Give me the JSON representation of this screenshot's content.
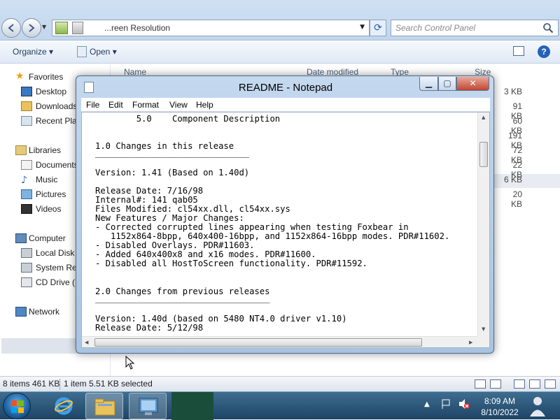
{
  "explorer": {
    "address_text": "...reen Resolution",
    "search_placeholder": "Search Control Panel",
    "toolbar": {
      "organize": "Organize",
      "open": "Open"
    },
    "columns": {
      "name": "Name",
      "date_modified": "Date modified",
      "type": "Type",
      "size": "Size"
    },
    "sizes": [
      "3 KB",
      "91 KB",
      "60 KB",
      "191 KB",
      "72 KB",
      "22 KB",
      "6 KB",
      "20 KB"
    ],
    "nav": {
      "favorites": "Favorites",
      "desktop": "Desktop",
      "downloads": "Downloads",
      "recent_places": "Recent Places",
      "libraries": "Libraries",
      "documents": "Documents",
      "music": "Music",
      "pictures": "Pictures",
      "videos": "Videos",
      "computer": "Computer",
      "local_disk": "Local Disk (C:)",
      "system_reserved": "System Reserved",
      "cd_drive": "CD Drive (E:)",
      "network": "Network"
    },
    "status": {
      "items": "8 items 461 KB",
      "selected": "1 item 5.51 KB selected"
    }
  },
  "notepad": {
    "title": "README - Notepad",
    "menu": [
      "File",
      "Edit",
      "Format",
      "View",
      "Help"
    ],
    "lines": [
      "        5.0    Component Description",
      "",
      "1.0 Changes in this release",
      "______________________________",
      "",
      "Version: 1.41 (Based on 1.40d)",
      "",
      "Release Date: 7/16/98",
      "Internal#: 141 qab05",
      "Files Modified: cl54xx.dll, cl54xx.sys",
      "New Features / Major Changes:",
      "- Corrected corrupted lines appearing when testing Foxbear in",
      "   1152x864-8bpp, 640x400-16bpp, and 1152x864-16bpp modes. PDR#11602.",
      "- Disabled Overlays. PDR#11603.",
      "- Added 640x400x8 and x16 modes. PDR#11600.",
      "- Disabled all HostToScreen functionality. PDR#11592.",
      "",
      "",
      "2.0 Changes from previous releases",
      "__________________________________",
      "",
      "Version: 1.40d (based on 5480 NT4.0 driver v1.10)",
      "Release Date: 5/12/98"
    ]
  },
  "taskbar": {
    "time": "8:09 AM",
    "date": "8/10/2022"
  },
  "colors": {
    "taskbar": "#1d4466",
    "notepad_frame": "#a9c4e1",
    "close_button": "#c1462f"
  }
}
